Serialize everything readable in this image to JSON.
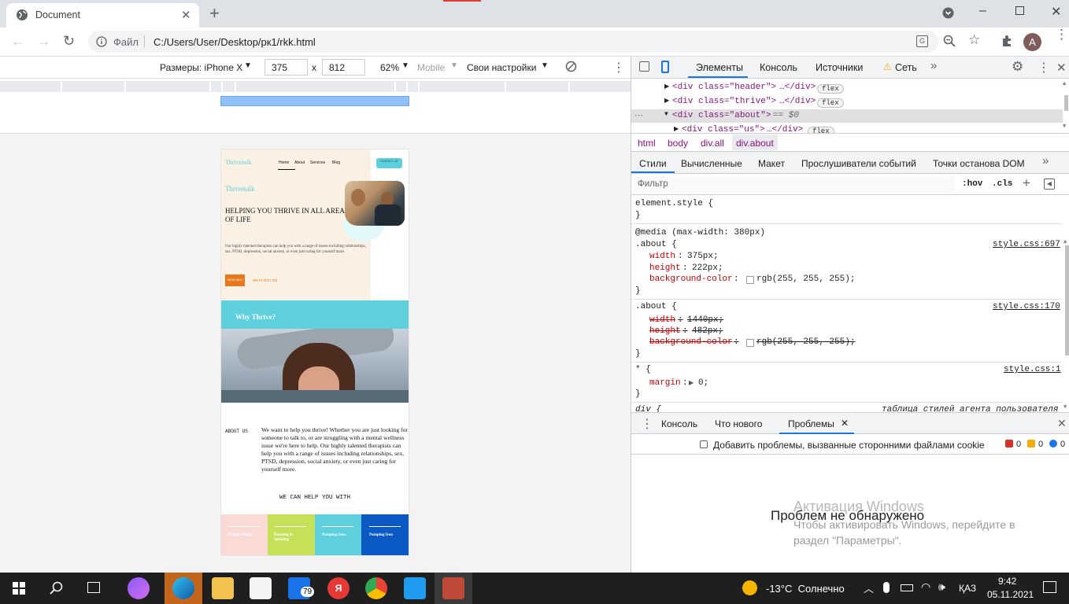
{
  "browser": {
    "tab_title": "Document",
    "address_label": "Файл",
    "address_url": "C:/Users/User/Desktop/рк1/rkk.html",
    "avatar_letter": "A"
  },
  "device_toolbar": {
    "device": "Размеры: iPhone X",
    "width": "375",
    "times": "x",
    "height": "812",
    "zoom": "62%",
    "throttle": "Mobile",
    "custom": "Свои настройки"
  },
  "site": {
    "nav_logo": "Thrivetalk",
    "nav_links": [
      "Home",
      "About",
      "Services",
      "Blog"
    ],
    "contact_btn": "CONTACT US",
    "hero_brand": "Thrivetalk",
    "hero_title": "HELPING YOU THRIVE IN ALL AREAS OF LIFE",
    "hero_text": "Our highly talented therapists can help you with a range of issues including relationships, sex, PTSD, depression, social anxiety, or even just caring for yourself more.",
    "btn_who": "WHO AM I",
    "btn_what": "WHAT DO I DO",
    "why_title": "Why Thrive?",
    "about_label": "ABOUT US",
    "about_text": "We want to help you thrive! Whether you are just looking for someone to talk to, or are struggling with a mental wellness issue we're here to help. Our highly talented therapists can help you with a range of issues including relationships, sex, PTSD, depression, social anxiety, or even just caring for yourself more.",
    "help_title": "WE CAN HELP YOU WITH",
    "cards": [
      {
        "label": "Weight Lifting",
        "color": "#fbd9d5"
      },
      {
        "label": "Running & Spinning",
        "color": "#c6e05a"
      },
      {
        "label": "Pumping Iron",
        "color": "#5ecfdd"
      },
      {
        "label": "Pumping Iron",
        "color": "#0a59c4"
      }
    ]
  },
  "devtools": {
    "tabs": [
      "Элементы",
      "Консоль",
      "Источники",
      "Сеть"
    ],
    "dom": [
      {
        "open": "<div class=\"header\">",
        "rest": "…</div>",
        "badge": "flex"
      },
      {
        "open": "<div class=\"thrive\">",
        "rest": "…</div>",
        "badge": "flex"
      },
      {
        "open": "<div class=\"about\">",
        "rest": "== $0",
        "badge": ""
      },
      {
        "open": "<div class=\"us\">",
        "rest": "…</div>",
        "badge": "flex"
      }
    ],
    "breadcrumbs": [
      "html",
      "body",
      "div.all",
      "div.about"
    ],
    "style_tabs": [
      "Стили",
      "Вычисленные",
      "Макет",
      "Прослушиватели событий",
      "Точки останова DOM"
    ],
    "filter_placeholder": "Фильтр",
    "hov": ":hov",
    "cls": ".cls",
    "element_style": "element.style {",
    "close_brace": "}",
    "media": "@media (max-width: 380px)",
    "rule1": {
      "selector": ".about {",
      "source": "style.css:697",
      "props": [
        {
          "name": "width",
          "value": "375px;"
        },
        {
          "name": "height",
          "value": "222px;"
        },
        {
          "name": "background-color",
          "value": "rgb(255, 255, 255);"
        }
      ]
    },
    "rule2": {
      "selector": ".about {",
      "source": "style.css:170",
      "props": [
        {
          "name": "width",
          "value": "1440px;"
        },
        {
          "name": "height",
          "value": "482px;"
        },
        {
          "name": "background-color",
          "value": "rgb(255, 255, 255);"
        }
      ]
    },
    "rule3": {
      "selector": "* {",
      "source": "style.css:1",
      "props": [
        {
          "name": "margin",
          "value": "0;"
        }
      ]
    },
    "rule4": {
      "selector": "div {",
      "source": "таблица стилей агента пользователя"
    },
    "drawer_tabs": [
      "Консоль",
      "Что нового",
      "Проблемы"
    ],
    "cookie_checkbox": "Добавить проблемы, вызванные сторонними файлами cookie",
    "counts": [
      "0",
      "0",
      "0"
    ],
    "no_problems": "Проблем не обнаружено",
    "watermark_title": "Активация Windows",
    "watermark_text": "Чтобы активировать Windows, перейдите в раздел \"Параметры\"."
  },
  "taskbar": {
    "mail_badge": "79",
    "weather": "-13°C  Солнечно",
    "lang": "ҚАЗ",
    "time": "9:42",
    "date": "05.11.2021"
  }
}
